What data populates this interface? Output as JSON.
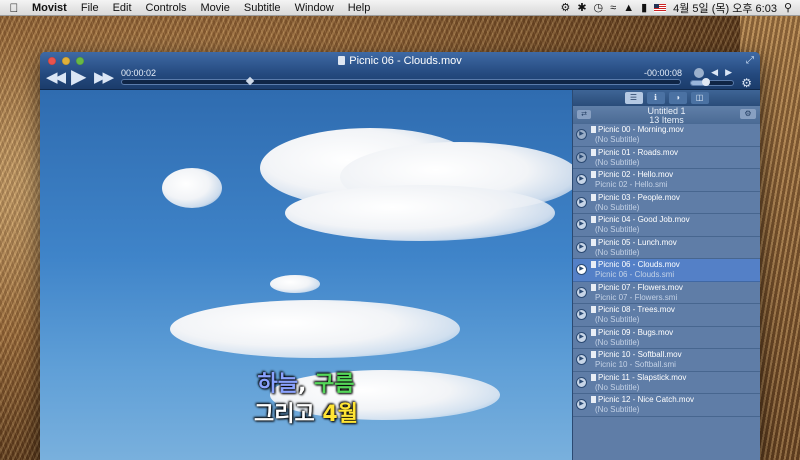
{
  "menubar": {
    "app_name": "Movist",
    "menus": [
      "File",
      "Edit",
      "Controls",
      "Movie",
      "Subtitle",
      "Window",
      "Help"
    ],
    "clock": "4월 5일 (목) 오후 6:03"
  },
  "window": {
    "title": "Picnic 06 - Clouds.mov",
    "time_elapsed": "00:00:02",
    "time_remaining": "-00:00:08",
    "seek_fraction": 0.23,
    "volume_fraction": 0.4
  },
  "subtitles": {
    "line1": [
      "하늘",
      ", ",
      "구름"
    ],
    "line2": [
      "그리고 ",
      "4월"
    ]
  },
  "playlist": {
    "name": "Untitled 1",
    "count": "13 Items",
    "items": [
      {
        "title": "Picnic 00 - Morning.mov",
        "subtitle": "(No Subtitle)"
      },
      {
        "title": "Picnic 01 - Roads.mov",
        "subtitle": "(No Subtitle)"
      },
      {
        "title": "Picnic 02 - Hello.mov",
        "subtitle": "Picnic 02 - Hello.smi"
      },
      {
        "title": "Picnic 03 - People.mov",
        "subtitle": "(No Subtitle)"
      },
      {
        "title": "Picnic 04 - Good Job.mov",
        "subtitle": "(No Subtitle)"
      },
      {
        "title": "Picnic 05 - Lunch.mov",
        "subtitle": "(No Subtitle)"
      },
      {
        "title": "Picnic 06 - Clouds.mov",
        "subtitle": "Picnic 06 - Clouds.smi"
      },
      {
        "title": "Picnic 07 - Flowers.mov",
        "subtitle": "Picnic 07 - Flowers.smi"
      },
      {
        "title": "Picnic 08 - Trees.mov",
        "subtitle": "(No Subtitle)"
      },
      {
        "title": "Picnic 09 - Bugs.mov",
        "subtitle": "(No Subtitle)"
      },
      {
        "title": "Picnic 10 - Softball.mov",
        "subtitle": "Picnic 10 - Softball.smi"
      },
      {
        "title": "Picnic 11 - Slapstick.mov",
        "subtitle": "(No Subtitle)"
      },
      {
        "title": "Picnic 12 - Nice Catch.mov",
        "subtitle": "(No Subtitle)"
      }
    ]
  }
}
